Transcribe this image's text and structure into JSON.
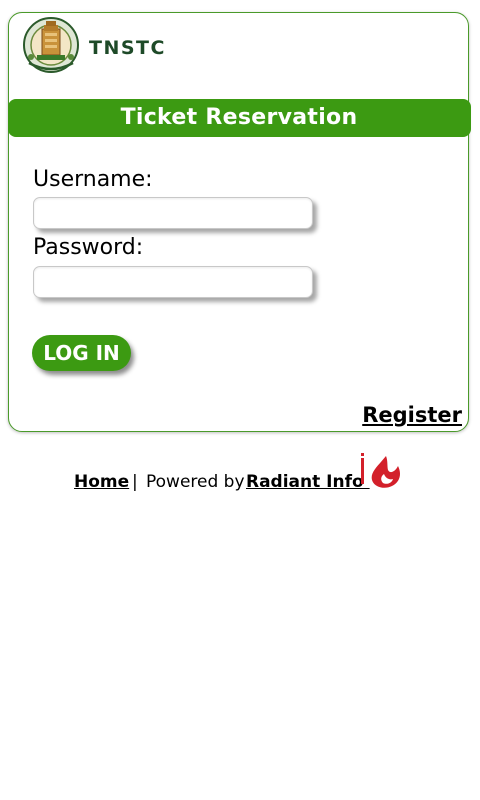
{
  "header": {
    "brand": "TNSTC",
    "emblem_icon": "tamil-nadu-emblem-icon"
  },
  "title_bar": {
    "label": "Ticket Reservation"
  },
  "form": {
    "username_label": "Username:",
    "username_value": "",
    "password_label": "Password:",
    "password_value": "",
    "login_label": "LOG IN"
  },
  "register_label": "Register",
  "footer": {
    "home_label": "Home",
    "separator": "|",
    "powered_by": "Powered by",
    "radiant_label": "Radiant Info ",
    "logo_icon": "radiant-logo-icon"
  },
  "colors": {
    "accent_green": "#3c9a12",
    "border_green": "#4a9a2a",
    "brand_dark_green": "#1e4a28",
    "logo_red": "#d3202a"
  }
}
